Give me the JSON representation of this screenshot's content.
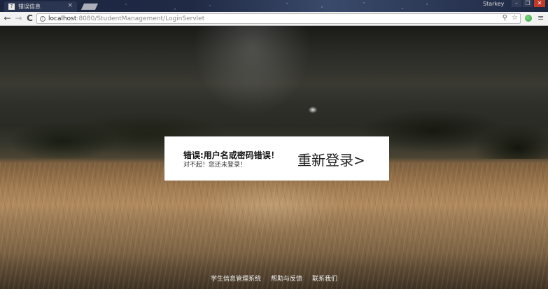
{
  "browser": {
    "tab_title": "错误信息",
    "tab_favicon": "?",
    "tab_close": "×",
    "profile_name": "Starkey",
    "window_controls": [
      "–",
      "❐",
      "✕"
    ],
    "nav": {
      "back": "←",
      "forward": "→",
      "reload": "C"
    },
    "url_host": "localhost",
    "url_path": ":8080/StudentManagement/LoginServlet",
    "info_icon": "i",
    "omnibox_icons": {
      "key": "⚲",
      "star": "☆"
    },
    "menu_icon": "≡"
  },
  "message": {
    "title": "错误:用户名或密码错误！",
    "subtitle": "对不起！您还未登录！",
    "relogin_label": "重新登录>"
  },
  "footer": {
    "links": [
      "学生信息管理系统",
      "帮助与反馈",
      "联系我们"
    ]
  }
}
